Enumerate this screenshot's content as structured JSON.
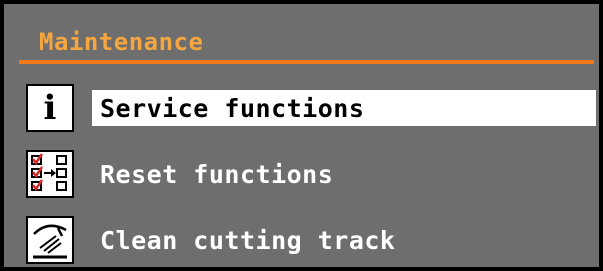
{
  "colors": {
    "accent": "#f07a1a",
    "background": "#6e6e6e",
    "selected_bg": "#ffffff",
    "title_text": "#f5a640",
    "check_red": "#d42a2a"
  },
  "header": {
    "title": "Maintenance"
  },
  "menu": {
    "items": [
      {
        "icon": "info-icon",
        "label": "Service functions",
        "selected": true
      },
      {
        "icon": "reset-checklist-icon",
        "label": "Reset functions",
        "selected": false
      },
      {
        "icon": "clean-cutting-track-icon",
        "label": "Clean cutting track",
        "selected": false
      }
    ]
  }
}
